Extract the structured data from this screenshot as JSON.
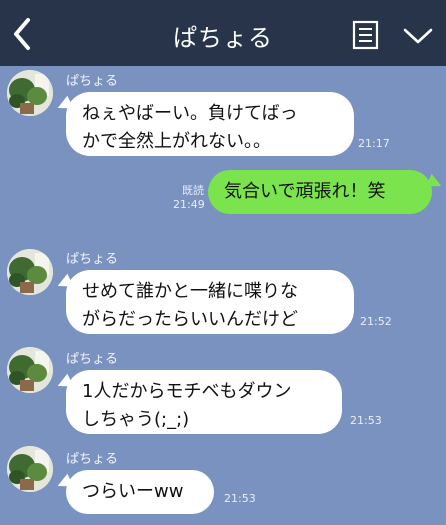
{
  "header": {
    "title": "ぱちょる"
  },
  "messages": [
    {
      "sender": "ぱちょる",
      "text": "ねぇやばーい。負けてばっ\nかで全然上がれない。。",
      "time": "21:17"
    },
    {
      "text": "気合いで頑張れ！笑",
      "read": "既読",
      "time": "21:49"
    },
    {
      "sender": "ぱちょる",
      "text": "せめて誰かと一緒に喋りな\nがらだったらいいんだけど",
      "time": "21:52"
    },
    {
      "sender": "ぱちょる",
      "text": "1人だからモチベもダウン\nしちゃう(;_;)",
      "time": "21:53"
    },
    {
      "sender": "ぱちょる",
      "text": "つらいーww",
      "time": "21:53"
    }
  ],
  "icons": {
    "back": "chevron-left-icon",
    "menu": "note-menu-icon",
    "collapse": "chevron-down-icon",
    "avatar": "plant-avatar"
  },
  "colors": {
    "header": "#27344a",
    "background": "#7a92c0",
    "incoming_bubble": "#ffffff",
    "outgoing_bubble": "#7be34e"
  }
}
